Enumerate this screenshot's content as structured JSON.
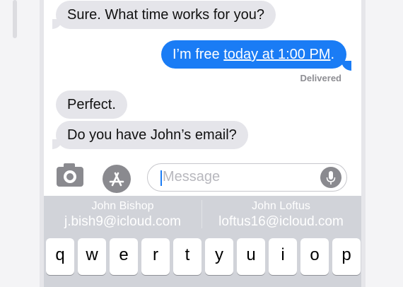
{
  "conversation": {
    "messages": [
      {
        "direction": "in",
        "text": "Sure. What time works for you?"
      },
      {
        "direction": "out",
        "prefix": "I’m free ",
        "link": "today at 1:00 PM",
        "suffix": "."
      },
      {
        "direction": "in",
        "text": "Perfect."
      },
      {
        "direction": "in",
        "text": "Do you have John’s email?"
      }
    ],
    "status": "Delivered"
  },
  "compose": {
    "placeholder": "Message",
    "camera_icon": "camera-icon",
    "apps_icon": "app-store-icon",
    "mic_icon": "microphone-icon"
  },
  "suggestions": [
    {
      "name": "John Bishop",
      "email": "j.bish9@icloud.com"
    },
    {
      "name": "John Loftus",
      "email": "loftus16@icloud.com"
    }
  ],
  "keyboard": {
    "row1": [
      "q",
      "w",
      "e",
      "r",
      "t",
      "y",
      "u",
      "i",
      "o",
      "p"
    ]
  },
  "colors": {
    "outgoing_bubble": "#1a7cf5",
    "incoming_bubble": "#e5e5ea",
    "keyboard_bg": "#d1d3d9"
  }
}
